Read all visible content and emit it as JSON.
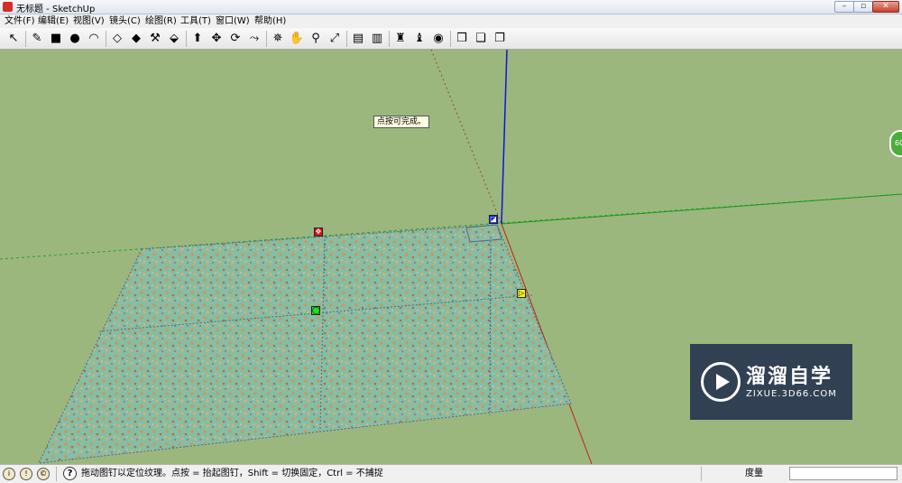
{
  "window": {
    "title": "无标题 - SketchUp"
  },
  "menu": [
    "文件(F)",
    "编辑(E)",
    "视图(V)",
    "镜头(C)",
    "绘图(R)",
    "工具(T)",
    "窗口(W)",
    "帮助(H)"
  ],
  "toolbar": [
    {
      "name": "select-tool-icon",
      "glyph": "↖"
    },
    {
      "sep": true
    },
    {
      "name": "pencil-tool-icon",
      "glyph": "✎"
    },
    {
      "name": "rectangle-tool-icon",
      "glyph": "■"
    },
    {
      "name": "circle-tool-icon",
      "glyph": "●"
    },
    {
      "name": "arc-tool-icon",
      "glyph": "◠"
    },
    {
      "sep": true
    },
    {
      "name": "make-component-icon",
      "glyph": "◇"
    },
    {
      "name": "eraser-tool-icon",
      "glyph": "◆"
    },
    {
      "name": "tape-measure-icon",
      "glyph": "⚒"
    },
    {
      "name": "paint-bucket-icon",
      "glyph": "⬙"
    },
    {
      "sep": true
    },
    {
      "name": "push-pull-icon",
      "glyph": "⬆"
    },
    {
      "name": "move-tool-icon",
      "glyph": "✥"
    },
    {
      "name": "rotate-tool-icon",
      "glyph": "⟳"
    },
    {
      "name": "follow-me-icon",
      "glyph": "⤳"
    },
    {
      "sep": true
    },
    {
      "name": "orbit-tool-icon",
      "glyph": "✵"
    },
    {
      "name": "pan-tool-icon",
      "glyph": "✋"
    },
    {
      "name": "zoom-tool-icon",
      "glyph": "⚲"
    },
    {
      "name": "zoom-extents-icon",
      "glyph": "⤢"
    },
    {
      "sep": true
    },
    {
      "name": "get-models-icon",
      "glyph": "▤"
    },
    {
      "name": "share-model-icon",
      "glyph": "▥"
    },
    {
      "sep": true
    },
    {
      "name": "component-warehouse-icon",
      "glyph": "♜"
    },
    {
      "name": "extension-warehouse-icon",
      "glyph": "♝"
    },
    {
      "name": "google-earth-icon",
      "glyph": "◉"
    },
    {
      "sep": true
    },
    {
      "name": "style-xray-icon",
      "glyph": "❒"
    },
    {
      "name": "style-wireframe-icon",
      "glyph": "❑"
    },
    {
      "name": "style-shaded-icon",
      "glyph": "❐"
    }
  ],
  "tooltip": "点按可完成。",
  "side_badge": "60",
  "pins": [
    {
      "name": "red-pin-move",
      "glyph": "✥",
      "color": "#e01010"
    },
    {
      "name": "blue-pin-distort",
      "glyph": "◪",
      "color": "#1020e0"
    },
    {
      "name": "green-pin-scale-rotate",
      "glyph": "◯",
      "color": "#20e020"
    },
    {
      "name": "yellow-pin-scale-shear",
      "glyph": "▷",
      "color": "#f0f020"
    }
  ],
  "watermark": {
    "title": "溜溜自学",
    "url": "ZIXUE.3D66.COM"
  },
  "status": {
    "message": "拖动图钉以定位纹理。点按 = 抬起图钉，Shift = 切换固定，Ctrl = 不捕捉",
    "measure_label": "度量",
    "measure_value": ""
  },
  "colors": {
    "sky": "#9bb77e",
    "axis_red": "#c0201c",
    "axis_green": "#1a8f1a",
    "axis_blue": "#1414d2"
  }
}
